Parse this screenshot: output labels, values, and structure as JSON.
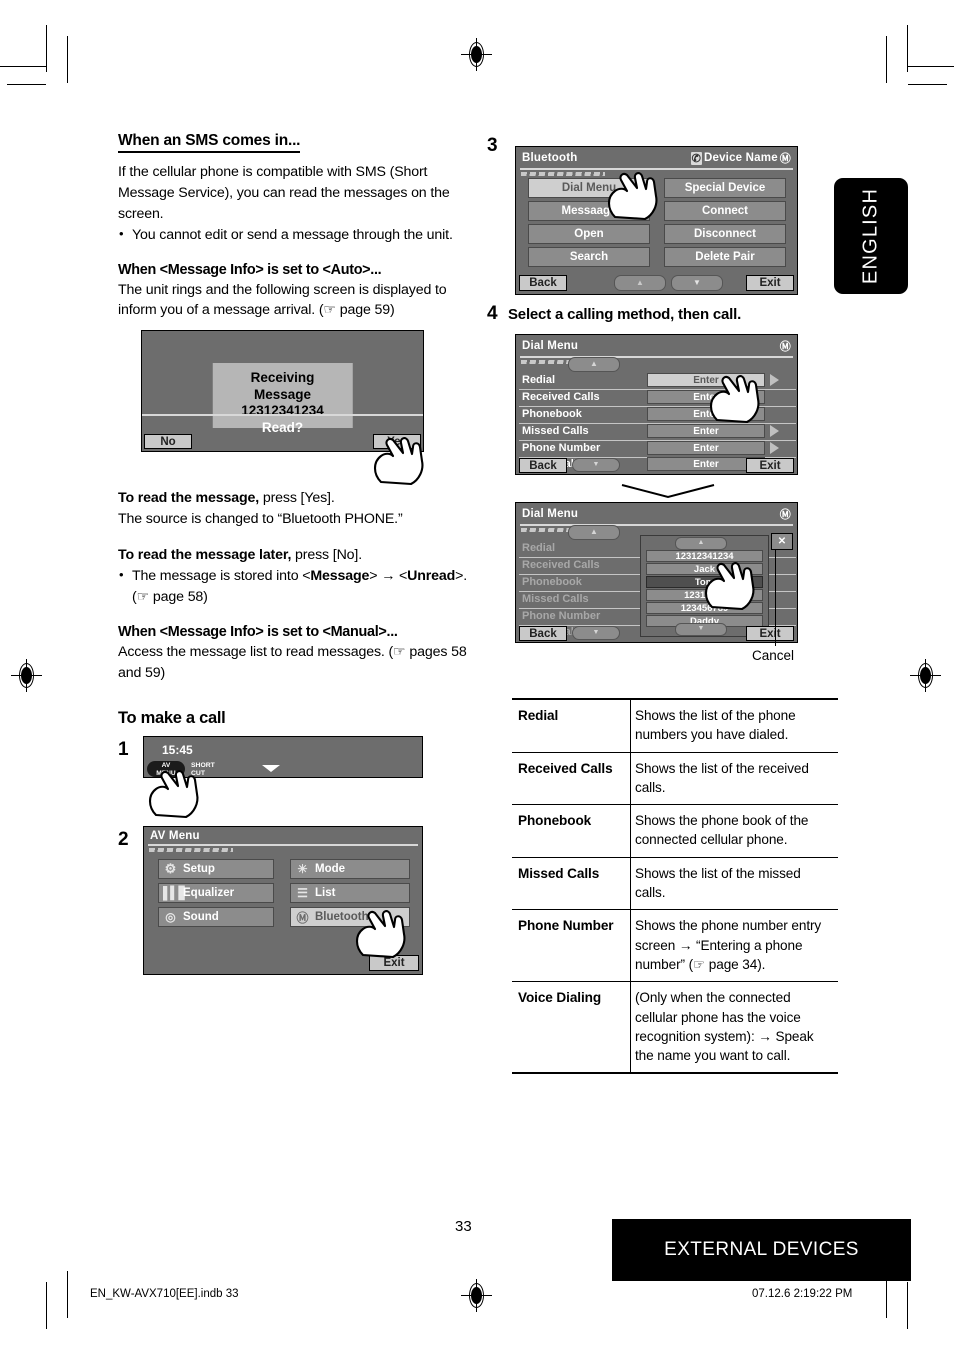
{
  "language_tab": "ENGLISH",
  "page_number": "33",
  "footer": {
    "section_banner": "EXTERNAL DEVICES",
    "file_ref": "EN_KW-AVX710[EE].indb   33",
    "timestamp": "07.12.6   2:19:22 PM"
  },
  "left_column": {
    "sms_heading": "When an SMS comes in...",
    "sms_body": "If the cellular phone is compatible with SMS (Short Message Service), you can read the messages on the screen.",
    "sms_bullet": "You cannot edit or send a message through the unit.",
    "auto_heading": "When <Message Info> is set to <Auto>...",
    "auto_body": "The unit rings and the following screen is displayed to inform you of a message arrival. (☞ page 59)",
    "read_msg_bold": "To read the message,",
    "read_msg_rest": " press [Yes].",
    "read_msg_note": "The source is changed to “Bluetooth PHONE.”",
    "read_later_bold": "To read the message later,",
    "read_later_rest": " press [No].",
    "read_later_bullet_1": "The message is stored into  <",
    "read_later_bullet_msg": "Message",
    "read_later_bullet_2": "> → <",
    "read_later_bullet_unread": "Unread",
    "read_later_bullet_3": ">. (☞ page 58)",
    "manual_heading": "When <Message Info> is set to <Manual>...",
    "manual_body": "Access the message list to read messages. (☞ pages 58 and 59)",
    "make_call_heading": "To make a call",
    "step1_number": "1",
    "step2_number": "2"
  },
  "receiving_screen": {
    "message_title": "Receiving Message",
    "message_number": "12312341234",
    "prompt": "Read?",
    "no_button": "No",
    "yes_button": "Yes"
  },
  "clock_screen": {
    "time": "15:45",
    "av_menu_line1": "AV",
    "av_menu_line2": "MENU",
    "shortcut_line1": "SHORT",
    "shortcut_line2": "CUT"
  },
  "av_menu_screen": {
    "title": "AV Menu",
    "left_items": [
      {
        "label": "Setup",
        "icon": "gear-icon"
      },
      {
        "label": "Equalizer",
        "icon": "equalizer-icon"
      },
      {
        "label": "Sound",
        "icon": "sound-icon"
      }
    ],
    "right_items": [
      {
        "label": "Mode",
        "icon": "mode-icon"
      },
      {
        "label": "List",
        "icon": "list-icon"
      },
      {
        "label": "Bluetooth",
        "icon": "bluetooth-icon"
      }
    ],
    "exit_button": "Exit"
  },
  "right_column": {
    "step3_number": "3",
    "step4_number": "4",
    "step4_text": "Select a calling method, then call.",
    "cancel_caption": "Cancel"
  },
  "bluetooth_screen": {
    "title": "Bluetooth",
    "device_name": "Device Name",
    "left_items": [
      "Dial Menu",
      "Messaage",
      "Open",
      "Search"
    ],
    "right_items": [
      "Special Device",
      "Connect",
      "Disconnect",
      "Delete Pair"
    ],
    "selected_item": "Dial Menu",
    "back_button": "Back",
    "exit_button": "Exit",
    "scroll_up": "▲",
    "scroll_down": "▼"
  },
  "dial_menu_screen": {
    "title": "Dial Menu",
    "rows": [
      "Redial",
      "Received Calls",
      "Phonebook",
      "Missed Calls",
      "Phone Number",
      "Voice Dialing"
    ],
    "enter_label": "Enter",
    "selected_row": "Redial",
    "back_button": "Back",
    "exit_button": "Exit"
  },
  "dial_menu_list_screen": {
    "title": "Dial Menu",
    "rows": [
      "Redial",
      "Received Calls",
      "Phonebook",
      "Missed Calls",
      "Phone Number",
      "Voice Dialing"
    ],
    "list_items": [
      "12312341234",
      "Jack",
      "Tom",
      "12311112",
      "123456789",
      "Daddy"
    ],
    "selected_list_item": "Tom",
    "close_icon": "✕",
    "back_button": "Back",
    "exit_button": "Exit"
  },
  "function_table": {
    "rows": [
      {
        "key": "Redial",
        "desc": "Shows the list of the phone numbers you have dialed."
      },
      {
        "key": "Received Calls",
        "desc": "Shows the list of the received calls."
      },
      {
        "key": "Phonebook",
        "desc": "Shows the phone book of the connected cellular phone."
      },
      {
        "key": "Missed Calls",
        "desc": "Shows the list of the missed calls."
      },
      {
        "key": "Phone Number",
        "desc": " Shows the phone number entry screen → “Entering a phone number” (☞ page 34)."
      },
      {
        "key": "Voice Dialing",
        "desc": "(Only when the connected cellular phone has the voice recognition system): → Speak the name you want to call."
      }
    ]
  }
}
